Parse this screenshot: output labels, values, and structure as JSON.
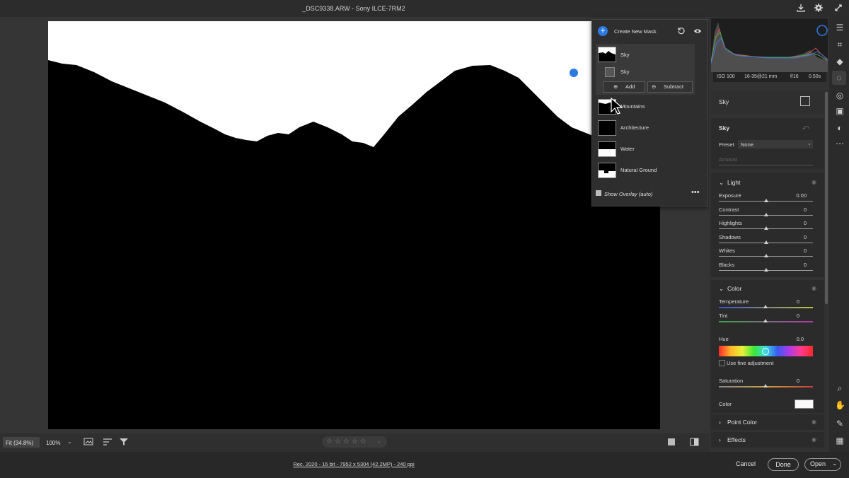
{
  "titlebar": {
    "title": "_DSC9338.ARW  -  Sony ILCE-7RM2"
  },
  "mask_panel": {
    "create_label": "Create New Mask",
    "active_mask": "Sky",
    "component": "Sky",
    "add_label": "Add",
    "subtract_label": "Subtract",
    "options": [
      "Mountains",
      "Architecture",
      "Water",
      "Natural Ground"
    ],
    "overlay_label": "Show Overlay (auto)"
  },
  "histogram": {
    "iso": "ISO 100",
    "lens": "16-35@21 mm",
    "aperture": "f/16",
    "shutter": "0.50s"
  },
  "panel": {
    "mask_name": "Sky",
    "component_name": "Sky",
    "preset_label": "Preset",
    "preset_value": "None",
    "amount_label": "Amount"
  },
  "light": {
    "title": "Light",
    "sliders": [
      {
        "label": "Exposure",
        "value": "0.00",
        "position": 0.5
      },
      {
        "label": "Contrast",
        "value": "0",
        "position": 0.5
      },
      {
        "label": "Highlights",
        "value": "0",
        "position": 0.5
      },
      {
        "label": "Shadows",
        "value": "0",
        "position": 0.5
      },
      {
        "label": "Whites",
        "value": "0",
        "position": 0.5
      },
      {
        "label": "Blacks",
        "value": "0",
        "position": 0.5
      }
    ]
  },
  "color": {
    "title": "Color",
    "temperature_label": "Temperature",
    "temperature_value": "0",
    "tint_label": "Tint",
    "tint_value": "0",
    "hue_label": "Hue",
    "hue_value": "0.0",
    "fine_label": "Use fine adjustment",
    "saturation_label": "Saturation",
    "saturation_value": "0",
    "color_label": "Color"
  },
  "sections": {
    "point_color": "Point Color",
    "effects": "Effects"
  },
  "bottombar": {
    "fit": "Fit (34.8%)",
    "zoom": "100%"
  },
  "footer": {
    "info": "Rec. 2020 - 16 bit - 7952 x 5304 (42.2MP) - 240 ppi",
    "cancel": "Cancel",
    "done": "Done",
    "open": "Open"
  },
  "colors": {
    "accent": "#2d7be0",
    "panel_bg": "#323232",
    "canvas_bg": "#353535"
  },
  "icons": [
    "download-icon",
    "gear-icon",
    "collapse-icon",
    "sliders-icon",
    "crop-icon",
    "eraser-icon",
    "mask-icon",
    "redeye-icon",
    "presets-icon",
    "more-icon",
    "zoom-icon",
    "hand-icon",
    "eyedropper-icon",
    "grid-icon",
    "eye-icon",
    "reset-icon",
    "sample-icon",
    "filter-icon",
    "sort-icon",
    "compare-icon",
    "before-after-icon"
  ]
}
